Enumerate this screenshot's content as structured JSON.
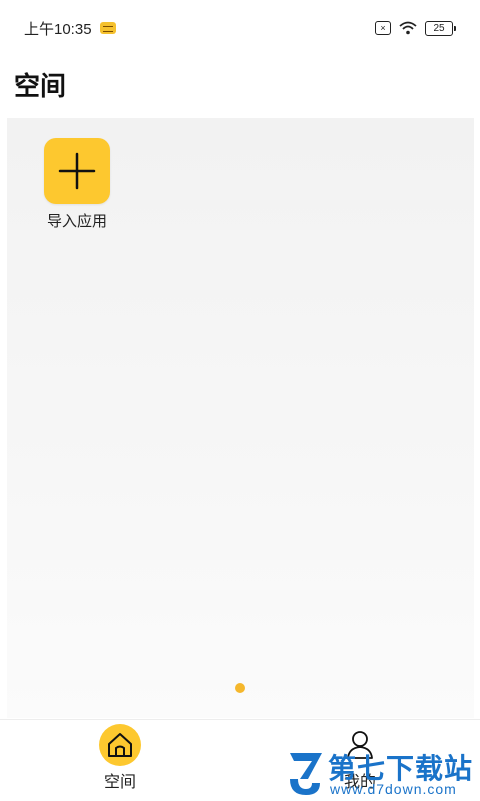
{
  "status_bar": {
    "time": "上午10:35",
    "sim_label": "×",
    "battery_level": "25"
  },
  "header": {
    "title": "空间"
  },
  "workspace": {
    "apps": [
      {
        "label": "导入应用",
        "icon": "plus-icon"
      }
    ],
    "page_indicator": {
      "pages": 1,
      "current": 1
    }
  },
  "bottom_nav": {
    "items": [
      {
        "label": "空间",
        "icon": "home-icon",
        "active": true
      },
      {
        "label": "我的",
        "icon": "person-icon",
        "active": false
      }
    ]
  },
  "watermark": {
    "title": "第七下载站",
    "url": "www.d7down.com"
  },
  "colors": {
    "accent": "#fdc82f",
    "dot": "#f5b72c",
    "watermark": "#1a73c9"
  }
}
